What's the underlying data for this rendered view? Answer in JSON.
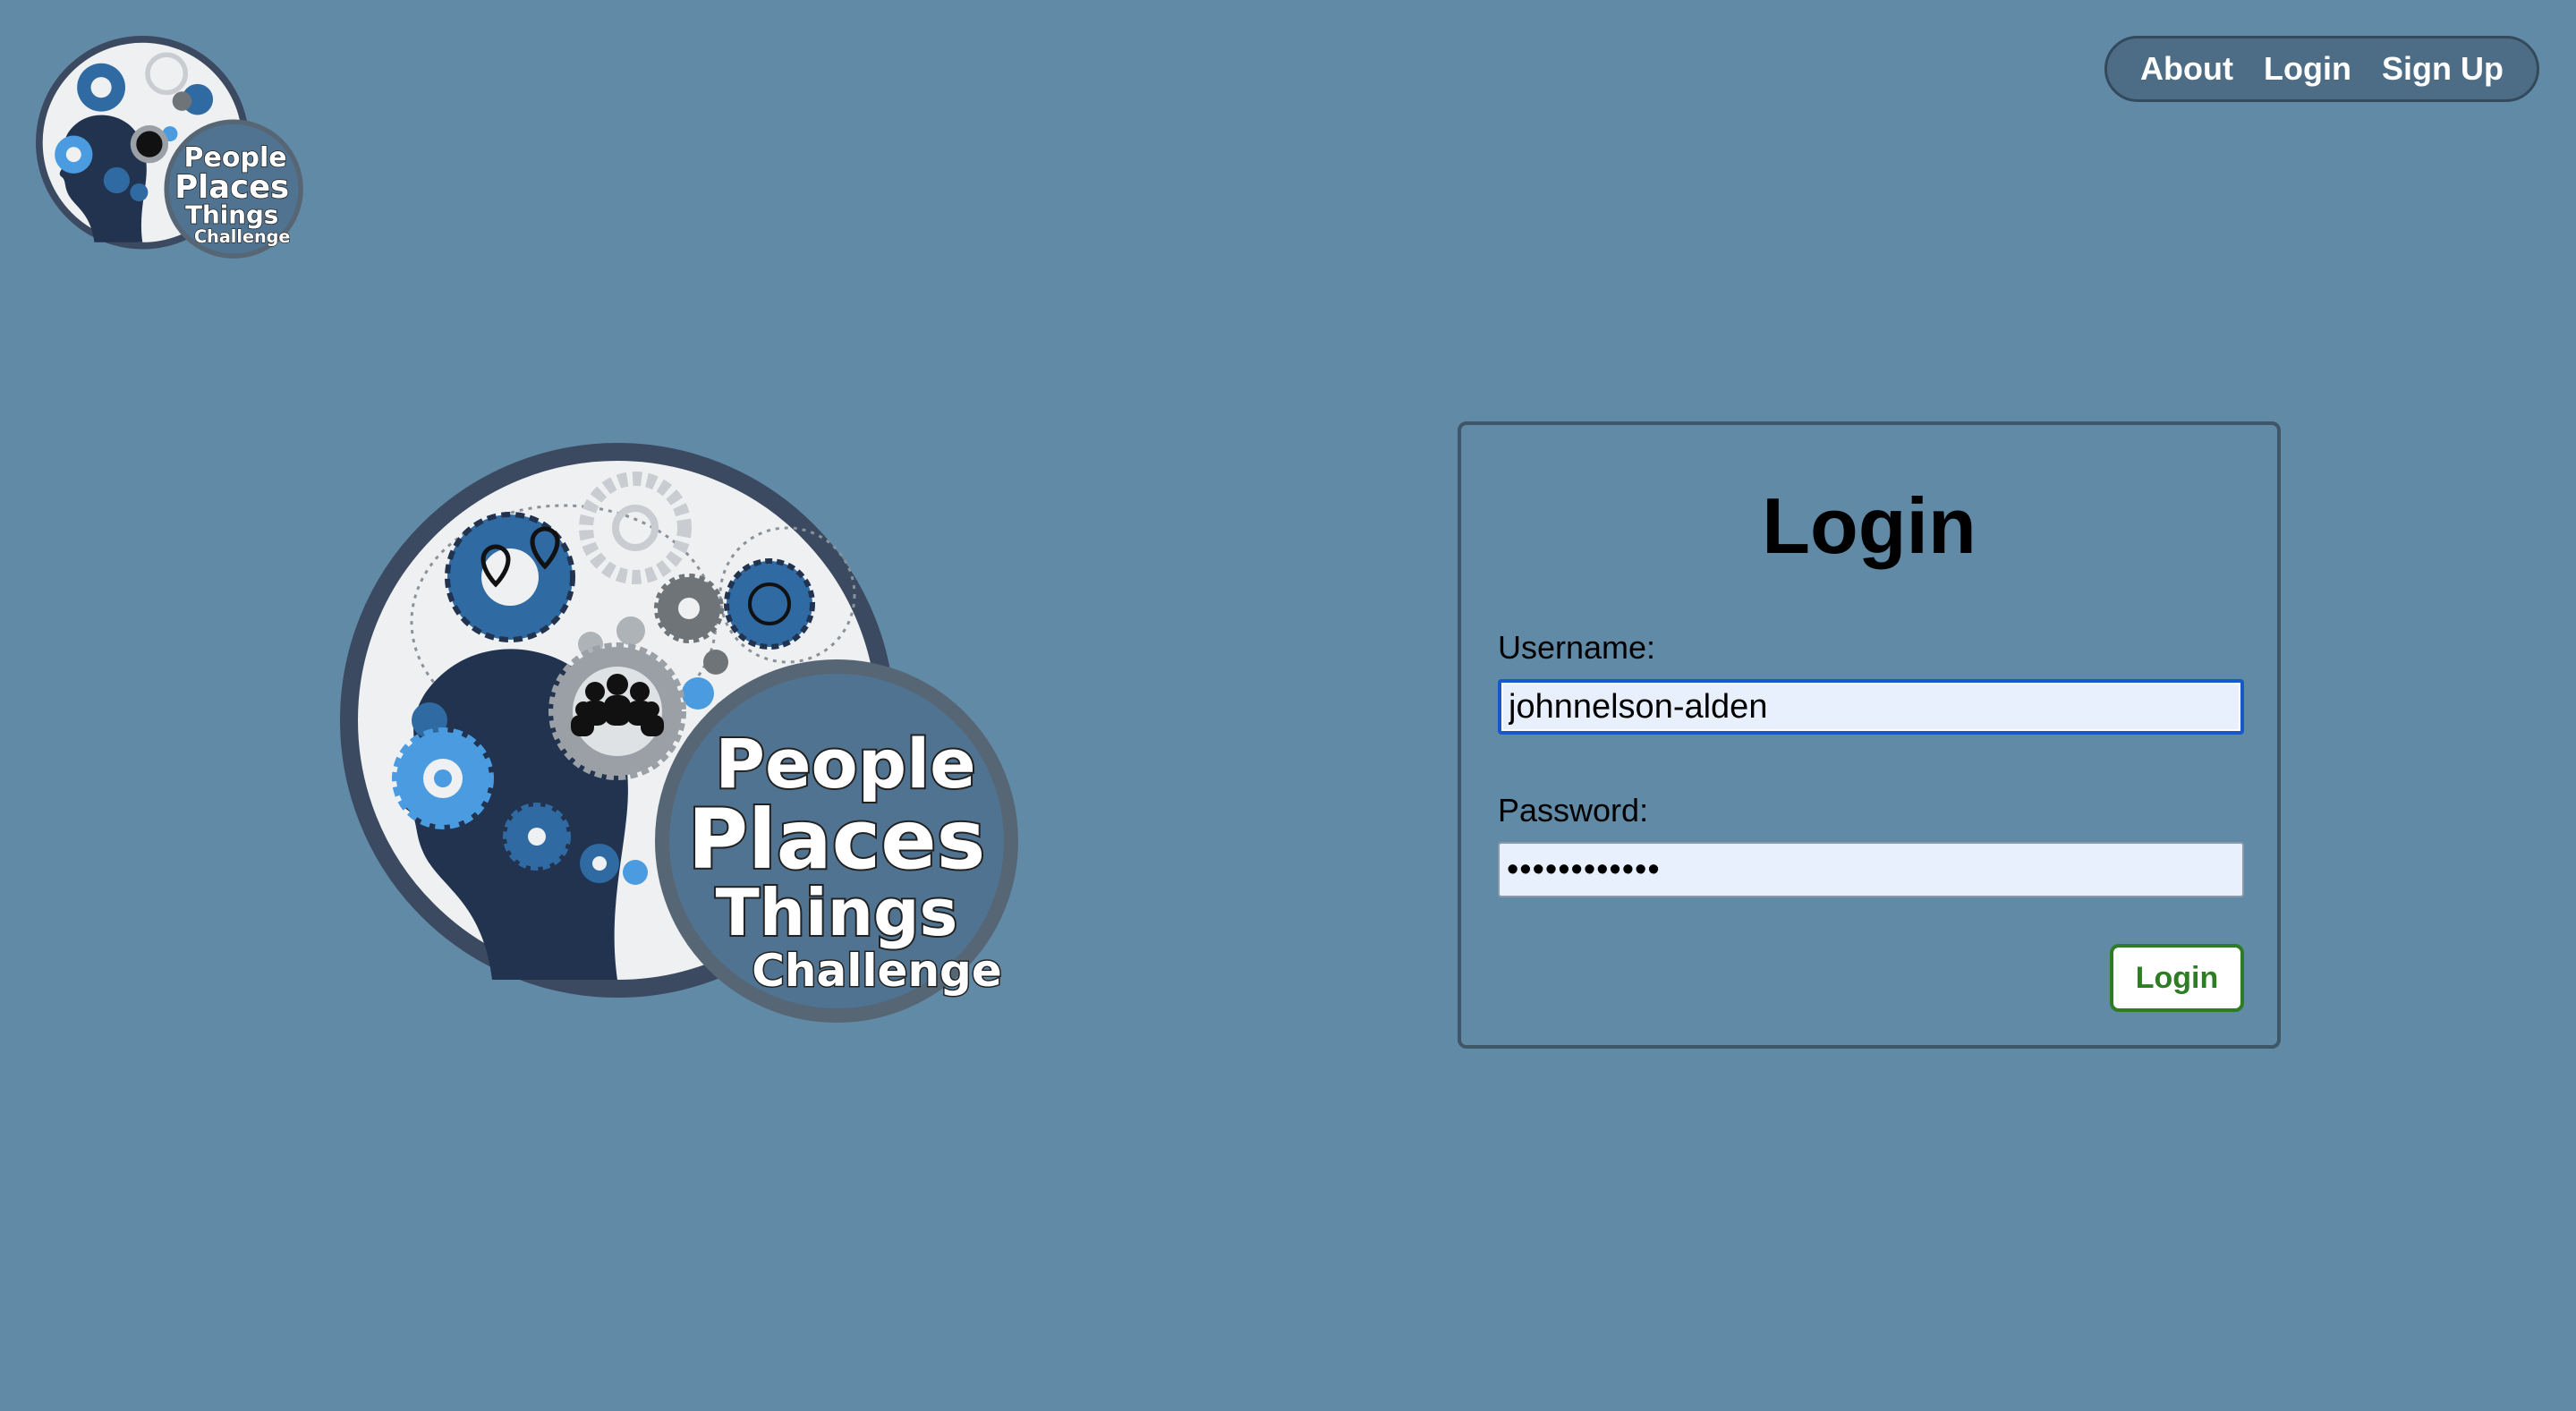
{
  "logo": {
    "line1": "People",
    "line2": "Places",
    "line3": "Things",
    "line4": "Challenge"
  },
  "nav": {
    "items": [
      {
        "label": "About"
      },
      {
        "label": "Login"
      },
      {
        "label": "Sign Up"
      }
    ]
  },
  "login_form": {
    "title": "Login",
    "username_label": "Username:",
    "username_value": "johnnelson-alden",
    "password_label": "Password:",
    "password_value": "••••••••••••",
    "submit_label": "Login"
  },
  "colors": {
    "background": "#618aa6",
    "nav_bg": "#4d6c85",
    "logo_navy": "#22334f",
    "logo_blue": "#2f6aa3",
    "logo_light_blue": "#4a9be0",
    "submit_green": "#2e7d26",
    "input_fill": "#e8f0fe"
  }
}
